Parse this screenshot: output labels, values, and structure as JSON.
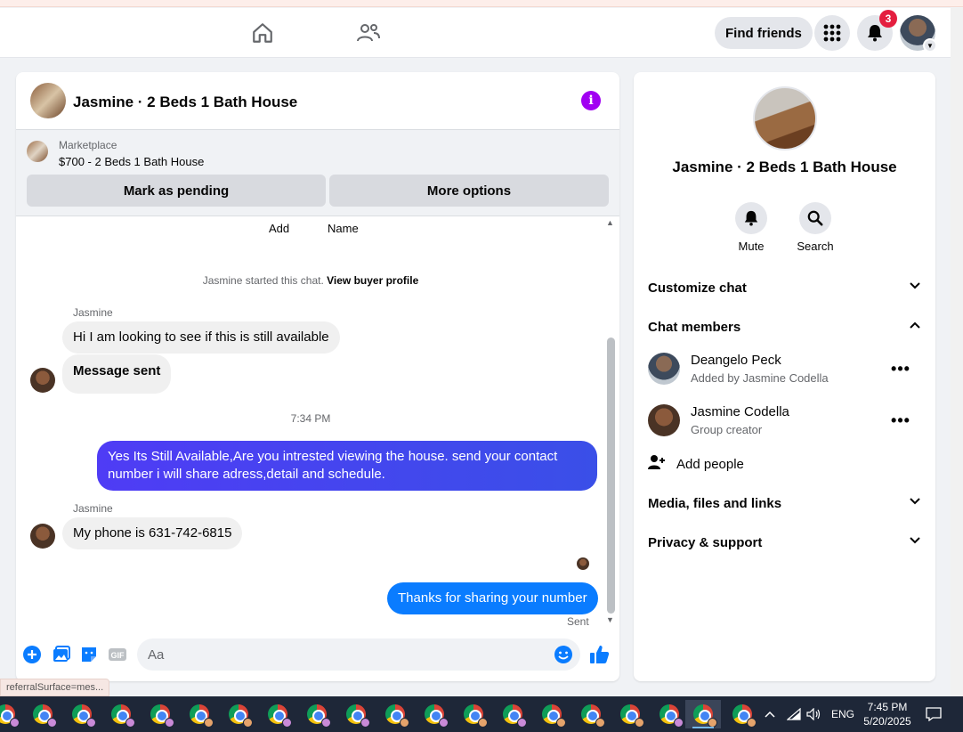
{
  "topnav": {
    "find_friends": "Find friends",
    "notification_count": "3"
  },
  "chat": {
    "title": "Jasmine · 2 Beds 1 Bath House",
    "marketplace_label": "Marketplace",
    "listing": "$700 - 2 Beds 1 Bath House",
    "mark_pending": "Mark as pending",
    "more_options": "More options",
    "partial_labels": [
      "Add",
      "Name"
    ],
    "system_prefix": "Jasmine started this chat.",
    "system_link": "View buyer profile",
    "messages": [
      {
        "sender": "Jasmine",
        "text": "Hi I am looking to see if this is still available"
      },
      {
        "text": "Message sent"
      },
      {
        "time": "7:34 PM"
      },
      {
        "text": "Yes Its Still Available,Are you intrested viewing the house. send your contact number i will share adress,detail and schedule."
      },
      {
        "sender": "Jasmine",
        "text": "My phone is 631-742-6815"
      },
      {
        "text": "Thanks for sharing your number"
      }
    ],
    "sent_status": "Sent",
    "composer_placeholder": "Aa"
  },
  "panel": {
    "title": "Jasmine · 2 Beds 1 Bath House",
    "mute": "Mute",
    "search": "Search",
    "customize": "Customize chat",
    "members_header": "Chat members",
    "members": [
      {
        "name": "Deangelo Peck",
        "sub": "Added by Jasmine Codella"
      },
      {
        "name": "Jasmine Codella",
        "sub": "Group creator"
      }
    ],
    "add_people": "Add people",
    "media": "Media, files and links",
    "privacy": "Privacy & support"
  },
  "status_url": "referralSurface=mes...",
  "taskbar": {
    "lang": "ENG",
    "time": "7:45 PM",
    "date": "5/20/2025"
  },
  "colors": {
    "accent_purple": "#a100f2",
    "bubble_out": "#4f3cf5",
    "bubble_out_blue": "#0a7cff",
    "badge_red": "#e41e3f"
  }
}
